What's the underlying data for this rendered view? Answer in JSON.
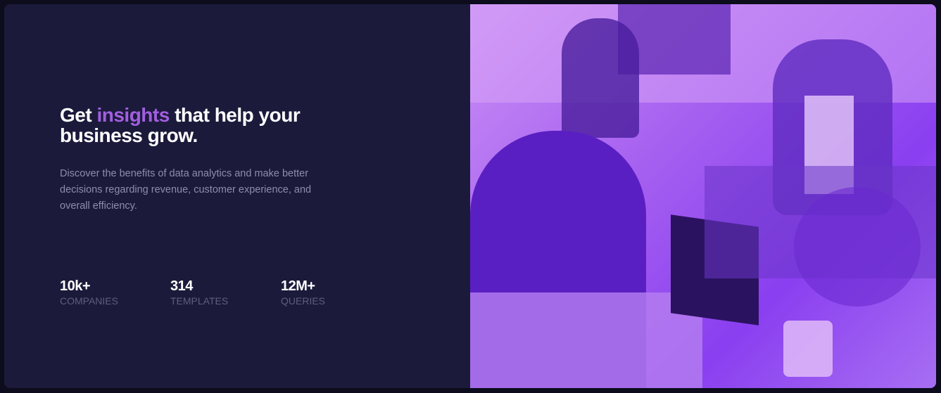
{
  "hero": {
    "title_before": "Get ",
    "title_accent": "insights",
    "title_after": " that help your business grow.",
    "description": "Discover the benefits of data analytics and make better decisions regarding revenue, customer experience, and overall efficiency.",
    "stats": [
      {
        "value": "10k+",
        "label": "COMPANIES"
      },
      {
        "value": "314",
        "label": "TEMPLATES"
      },
      {
        "value": "12M+",
        "label": "QUERIES"
      }
    ]
  },
  "colors": {
    "background": "#1b1a3b",
    "accent": "#a25ee0",
    "photo_tint": "#9b4ff0"
  },
  "image": {
    "description_icon": "office-team-photo"
  }
}
